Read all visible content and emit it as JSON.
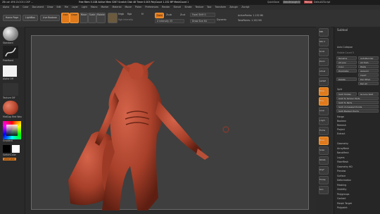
{
  "titlebar": {
    "left": "ZBrush 4R6 ZLOCK1 DSP ...",
    "center": "Free Mem 5.1GB  Active Mem 3267  Scratch Disk 46  Timer 0.003  PolyCount 1.152 MP  MeshCount 1",
    "right": [
      "QuickSave",
      "See-through 0",
      "Menus",
      "DefaultZScript"
    ]
  },
  "menu": [
    "Alpha",
    "Brush",
    "Color",
    "Document",
    "Draw",
    "Edit",
    "File",
    "Layer",
    "Light",
    "Macro",
    "Marker",
    "Material",
    "Movie",
    "Picker",
    "Preferences",
    "Render",
    "Stencil",
    "Stroke",
    "Texture",
    "Tool",
    "Transform",
    "Zplugin",
    "Zscript"
  ],
  "toolbar": {
    "home_page": "Home Page",
    "lightbox": "LightBox",
    "live_boolean": "Live Boolean",
    "edit": "Edit",
    "draw": "Draw",
    "move": "Move",
    "scale": "Scale",
    "rotate": "Rotate",
    "mrgb": "Mrgb",
    "rgb": "Rgb",
    "m": "M",
    "rgb_intensity": "Rgb Intensity",
    "zadd": "Zadd",
    "zsub": "Zsub",
    "zcut": "Zcut",
    "focal_shift": "Focal Shift 0",
    "z_intensity": "Z Intensity 25",
    "draw_size": "Draw Size 64",
    "dynamic": "Dynamic",
    "active_points": "ActivePoints: 1.152 Mil",
    "total_points": "TotalPoints: 1.152 Mil"
  },
  "lefttray": {
    "brush": "Standard",
    "stroke": "FreeHand",
    "alpha": "Alpha Off",
    "texture": "Texture Off",
    "material": "MatCap Red Wax",
    "gradient": "Gradient",
    "switch_color": "SwitchColor",
    "alternate": "Alternate"
  },
  "righttray": [
    "BPR",
    "SPix 3",
    "Scroll",
    "Zoom",
    "Actual",
    "AAHalf",
    "Persp",
    "Floor",
    "Local",
    "L.Sym",
    "Frame",
    "Move",
    "Scale",
    "Rotate",
    "PolyF",
    "Transp",
    "Solo"
  ],
  "panel": {
    "top": [
      "Subtool",
      "Auto Collapse"
    ],
    "visible_count": "Visible Count 5",
    "rows": [
      [
        "Rename",
        "AutoReorder"
      ],
      [
        "All Low",
        "All High"
      ],
      [
        "Copy",
        "Paste"
      ],
      [
        "Duplicate",
        "Append"
      ],
      [
        "",
        "Insert"
      ],
      [
        "Delete",
        "Del Other"
      ],
      [
        "",
        "Del All"
      ]
    ],
    "split_title": "Split",
    "split": [
      "Split Hidden",
      "Groups Split",
      "Split To Similar Parts",
      "Split To Parts",
      "Split Unmasked Points",
      "Split Masked Points"
    ],
    "merge": [
      "Merge",
      "Boolean",
      "Remesh",
      "Project",
      "Extract"
    ],
    "sections": [
      "Geometry",
      "ArrayMesh",
      "NanoMesh",
      "Layers",
      "FiberMesh",
      "Geometry HD",
      "Preview",
      "Surface",
      "Deformation",
      "Masking",
      "Visibility",
      "Polygroups",
      "Contact",
      "Morph Target",
      "Polypaint"
    ]
  },
  "colors": {
    "accent": "#e07a1c",
    "model": "#b9472f",
    "canvas": "#3f3f3f"
  }
}
